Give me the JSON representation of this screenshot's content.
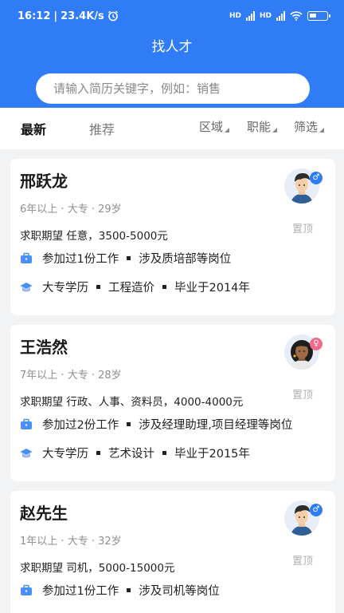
{
  "status_bar": {
    "time": "16:12",
    "speed": "23.4K/s",
    "hd1": "HD",
    "hd2": "HD"
  },
  "header": {
    "title": "找人才",
    "search_placeholder": "请输入简历关键字，例如：销售"
  },
  "tabs": [
    {
      "label": "最新",
      "active": true
    },
    {
      "label": "推荐",
      "active": false
    }
  ],
  "filters": [
    "区域",
    "职能",
    "筛选"
  ],
  "separator": "·",
  "candidates": [
    {
      "name": "邢跃龙",
      "experience": "6年以上",
      "education": "大专",
      "age": "29岁",
      "expectation": "求职期望 任意，3500-5000元",
      "work_exp": "参加过1份工作",
      "positions": "涉及质培部等岗位",
      "degree": "大专学历",
      "major": "工程造价",
      "graduation": "毕业于2014年",
      "gender_icon": "male",
      "gender_symbol": "♂",
      "pin_label": "置顶"
    },
    {
      "name": "王浩然",
      "experience": "7年以上",
      "education": "大专",
      "age": "28岁",
      "expectation": "求职期望 行政、人事、资料员，4000-4000元",
      "work_exp": "参加过2份工作",
      "positions": "涉及经理助理,项目经理等岗位",
      "degree": "大专学历",
      "major": "艺术设计",
      "graduation": "毕业于2015年",
      "gender_icon": "female",
      "gender_symbol": "♀",
      "pin_label": "置顶"
    },
    {
      "name": "赵先生",
      "experience": "1年以上",
      "education": "大专",
      "age": "32岁",
      "expectation": "求职期望 司机，5000-15000元",
      "work_exp": "参加过1份工作",
      "positions": "涉及司机等岗位",
      "degree": "",
      "major": "",
      "graduation": "",
      "gender_icon": "male",
      "gender_symbol": "♂",
      "pin_label": "置顶"
    }
  ],
  "colors": {
    "brand": "#2f7cf6",
    "male_badge": "#2f7cf6",
    "female_badge": "#f16b8a",
    "muted_text": "#8e8e8e"
  }
}
